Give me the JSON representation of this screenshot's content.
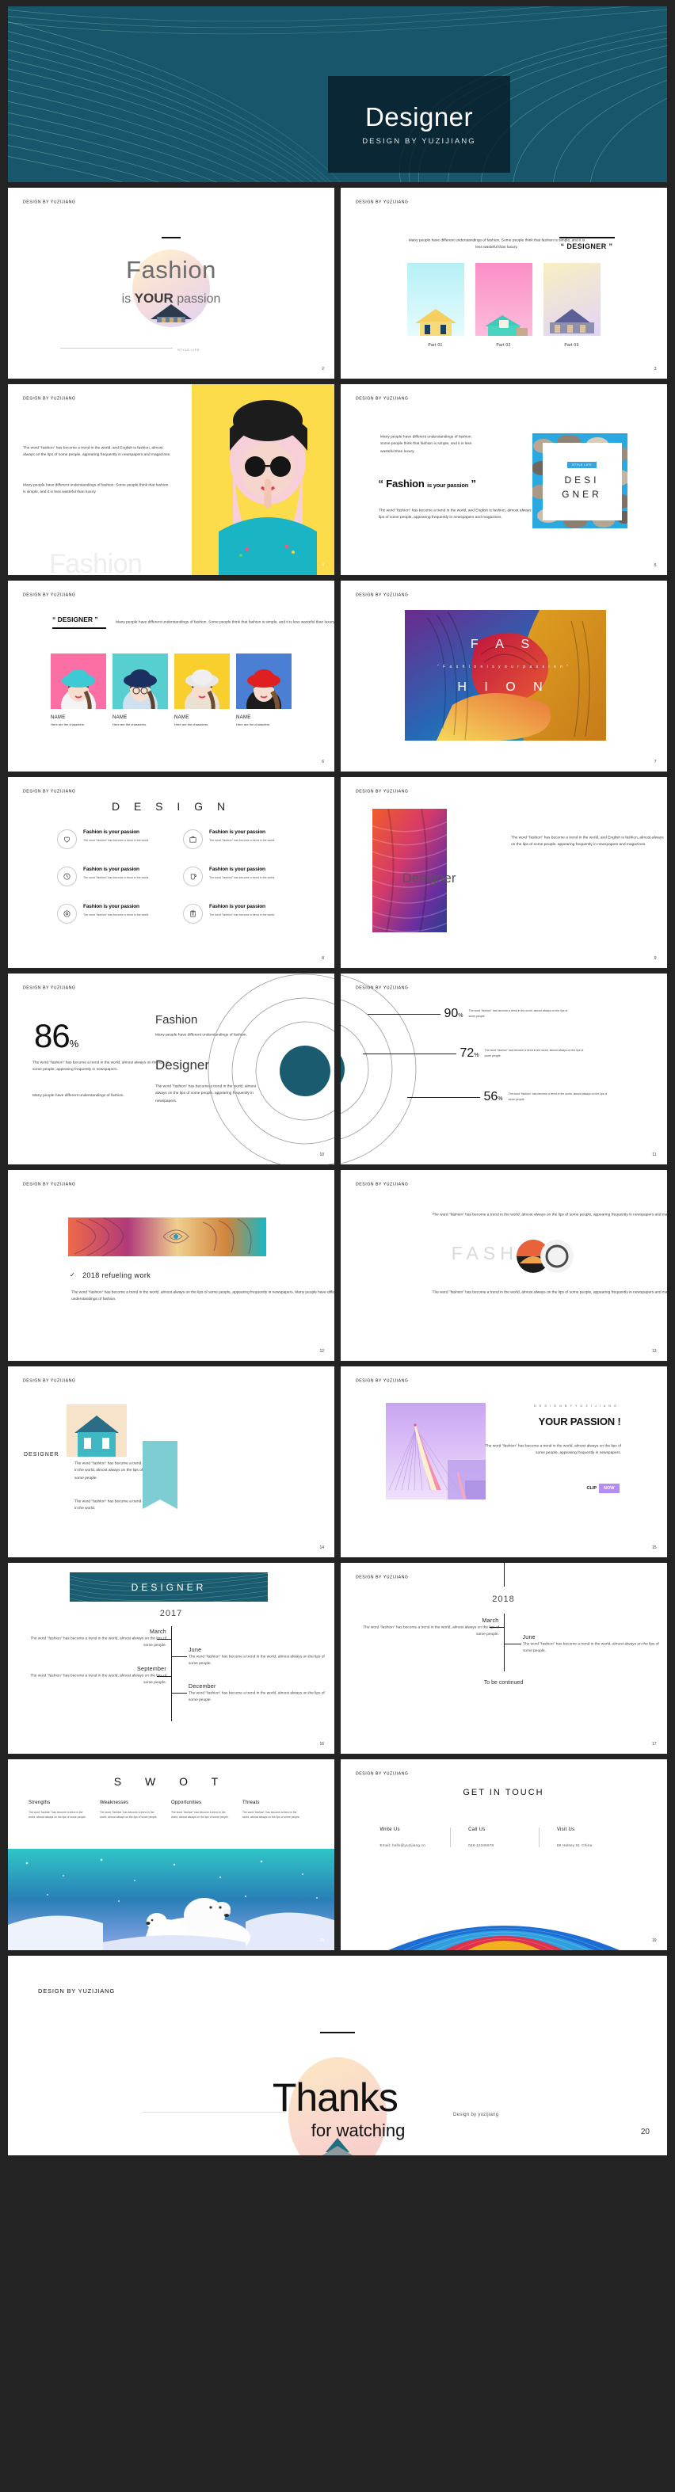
{
  "hero": {
    "title": "Designer",
    "subtitle": "DESIGN BY YUZIJIANG",
    "bg_color": "#18576b",
    "panel_color": "#081c28"
  },
  "common": {
    "header": "DESIGN BY YUZIJIANG",
    "lorem_short": "The word \"fashion\" has become a trend in the world.",
    "lorem_mid": "The word \"fashion\" has become a trend in the world, almost always on the lips of some people.",
    "lorem_long": "The word \"fashion\" has become a trend in the world, and English is fashion, almost always on the lips of some people, appearing frequently in newspapers and magazines.",
    "lorem_many": "Many people have different understandings of fashion. Some people think that fashion is simple, and it is less wasteful than luxury."
  },
  "slides": [
    {
      "page": "2",
      "name": "fashion-passion",
      "title_a": "Fashion",
      "title_b_pre": "is ",
      "title_b_strong": "YOUR",
      "title_b_post": " passion",
      "footer_label": "STYLE LIFE"
    },
    {
      "page": "3",
      "name": "parts-overview",
      "lead": "Many people have different understandings of fashion. Some people think that fashion is simple, and it is less wasteful than luxury.",
      "badge": "“ DESIGNER ”",
      "cards": [
        {
          "caption": "Part 01",
          "color": "#a8ecf3"
        },
        {
          "caption": "Part 02",
          "color": "#fba2d0"
        },
        {
          "caption": "Part 03",
          "color": "#e6d4f5"
        }
      ]
    },
    {
      "page": "4",
      "name": "fashion-photo",
      "p1": "The word \"fashion\" has become a trend in the world, and English is fashion, almost always on the lips of some people, appearing frequently in newspapers and magazines.",
      "p2": "Many people have different understandings of fashion. Some people think that fashion is simple, and it is less wasteful than luxury.",
      "ghost": "Fashion"
    },
    {
      "page": "5",
      "name": "designer-frame",
      "p1": "Many people have different understandings of fashion. Some people think that fashion is simple, and it is less wasteful than luxury.",
      "quote_pre": "“ Fashion ",
      "quote_small": "is your passion",
      "quote_post": " ”",
      "p2": "The word \"fashion\" has become a trend in the world, and English is fashion, almost always on the lips of some people, appearing frequently in newspapers and magazines.",
      "chip": "STYLE LIFE",
      "big_a": "DESI",
      "big_b": "GNER"
    },
    {
      "page": "6",
      "name": "team-members",
      "badge": "“ DESIGNER ”",
      "lead": "Many people have different understandings of fashion. Some people think that fashion is simple, and it is less wasteful than luxury.",
      "members": [
        {
          "name": "NAME",
          "desc": "Here are the characters.",
          "color": "#fb6fa4",
          "hat": "#3fc9d4"
        },
        {
          "name": "NAME",
          "desc": "Here are the characters.",
          "color": "#57cfd0",
          "hat": "#1b2f60"
        },
        {
          "name": "NAME",
          "desc": "Here are the characters.",
          "color": "#f9cf2e",
          "hat": "#e3e3e3"
        },
        {
          "name": "NAME",
          "desc": "Here are the characters.",
          "color": "#4a7fd4",
          "hat": "#e02020"
        }
      ]
    },
    {
      "page": "7",
      "name": "fashion-cover",
      "word_a": "F A S",
      "quote": "“  F a s h i o n   i s   y o u r   p a s s i o n  ”",
      "word_b": "H I O N"
    },
    {
      "page": "8",
      "name": "design-features",
      "title": "D E S I G N",
      "items": [
        {
          "icon": "heart-icon",
          "h": "Fashion is your passion",
          "p": "The word \"fashion\" has become a trend in the world."
        },
        {
          "icon": "briefcase-icon",
          "h": "Fashion is your passion",
          "p": "The word \"fashion\" has become a trend in the world."
        },
        {
          "icon": "clock-icon",
          "h": "Fashion is your passion",
          "p": "The word \"fashion\" has become a trend in the world."
        },
        {
          "icon": "cup-icon",
          "h": "Fashion is your passion",
          "p": "The word \"fashion\" has become a trend in the world."
        },
        {
          "icon": "target-icon",
          "h": "Fashion is your passion",
          "p": "The word \"fashion\" has become a trend in the world."
        },
        {
          "icon": "clipboard-icon",
          "h": "Fashion is your passion",
          "p": "The word \"fashion\" has become a trend in the world."
        }
      ]
    },
    {
      "page": "9",
      "name": "designer-spiral",
      "word": "Designer",
      "p": "The word \"fashion\" has become a trend in the world, and English is fashion, almost always on the lips of some people, appearing frequently in newspapers and magazines."
    },
    {
      "page": "10",
      "name": "stat-86",
      "value": "86",
      "unit": "%",
      "p1": "The word \"fashion\" has become a trend in the world, almost always on the lips of some people, appearing frequently in newspapers.",
      "p2": "Many people have different understandings of fashion.",
      "h1": "Fashion",
      "s1": "Many people have different understandings of fashion.",
      "h2": "Designer",
      "s2": "The word \"fashion\" has become a trend in the world, almost always on the lips of some people, appearing frequently in newspapers."
    },
    {
      "page": "11",
      "name": "stat-rings",
      "rows": [
        {
          "value": "90",
          "unit": "%",
          "desc": "The word \"fashion\" has become a trend in the world, almost always on the lips of some people."
        },
        {
          "value": "72",
          "unit": "%",
          "desc": "The word \"fashion\" has become a trend in the world, almost always on the lips of some people."
        },
        {
          "value": "56",
          "unit": "%",
          "desc": "The word \"fashion\" has become a trend in the world, almost always on the lips of some people."
        }
      ]
    },
    {
      "page": "12",
      "name": "refueling-work",
      "check": "✓",
      "heading": "2018 refueling  work",
      "p": "The word \"fashion\" has become a trend in the world, almost always on the lips of some people, appearing frequently in newspapers. Many people have different understandings of fashion."
    },
    {
      "page": "13",
      "name": "fashion-circles",
      "top": "The word \"fashion\" has become a trend in the world, almost always on the lips of some people, appearing frequently in newspapers and magazines.",
      "word": "FASHI  N",
      "bottom": "The word \"fashion\" has become a trend in the world, almost always on the lips of some people, appearing frequently in newspapers and magazines."
    },
    {
      "page": "14",
      "name": "designer-tag",
      "label": "DESIGNER",
      "p1": "The word \"fashion\" has become a trend in the world, almost always on the lips of some people.",
      "p2": "The word \"fashion\" has become a trend in the world."
    },
    {
      "page": "15",
      "name": "your-passion",
      "kicker": "D E S I G N   B Y   Y U Z I J I A N G",
      "heading": "YOUR PASSION !",
      "p": "The word \"fashion\" has become a trend in the world, almost always on the lips of some people, appearing frequently in newspapers.",
      "btn_a": "CLIP",
      "btn_b": "NOW"
    },
    {
      "page": "16",
      "name": "timeline-2017",
      "banner": "DESIGNER",
      "year": "2017",
      "items": [
        {
          "month": "March",
          "desc": "The word \"fashion\" has become a trend in the world, almost always on the lips of some people.",
          "side": "left"
        },
        {
          "month": "June",
          "desc": "The word \"fashion\" has become a trend in the world, almost always on the lips of some people.",
          "side": "right"
        },
        {
          "month": "September",
          "desc": "The word \"fashion\" has become a trend in the world, almost always on the lips of some people.",
          "side": "left"
        },
        {
          "month": "December",
          "desc": "The word \"fashion\" has become a trend in the world, almost always on the lips of some people.",
          "side": "right"
        }
      ]
    },
    {
      "page": "17",
      "name": "timeline-2018",
      "year": "2018",
      "items": [
        {
          "month": "March",
          "desc": "The word \"fashion\" has become a trend in the world, almost always on the lips of some people.",
          "side": "left"
        },
        {
          "month": "June",
          "desc": "The word \"fashion\" has become a trend in the world, almost always on the lips of some people.",
          "side": "right"
        }
      ],
      "end": "To be continued"
    },
    {
      "page": "18",
      "name": "swot",
      "title": "S W O T",
      "columns": [
        {
          "h": "Strengths",
          "p": "The word \"fashion\" has become a trend in the world, almost always on the lips of some people."
        },
        {
          "h": "Weaknesses",
          "p": "The word \"fashion\" has become a trend in the world, almost always on the lips of some people."
        },
        {
          "h": "Opportunities",
          "p": "The word \"fashion\" has become a trend in the world, almost always on the lips of some people."
        },
        {
          "h": "Threats",
          "p": "The word \"fashion\" has become a trend in the world, almost always on the lips of some people."
        }
      ]
    },
    {
      "page": "19",
      "name": "get-in-touch",
      "title": "GET IN TOUCH",
      "columns": [
        {
          "h": "Write Us",
          "v": "Email:  hello@yuzijiang.cn"
        },
        {
          "h": "Call Us",
          "v": "028-12345678"
        },
        {
          "h": "Visit Us",
          "v": "69 Halsey St. China"
        }
      ]
    }
  ],
  "final": {
    "page": "20",
    "header": "DESIGN BY YUZIJIANG",
    "thanks": "Thanks",
    "for_watching": "for watching",
    "by": "Design  by yuzijiang"
  }
}
